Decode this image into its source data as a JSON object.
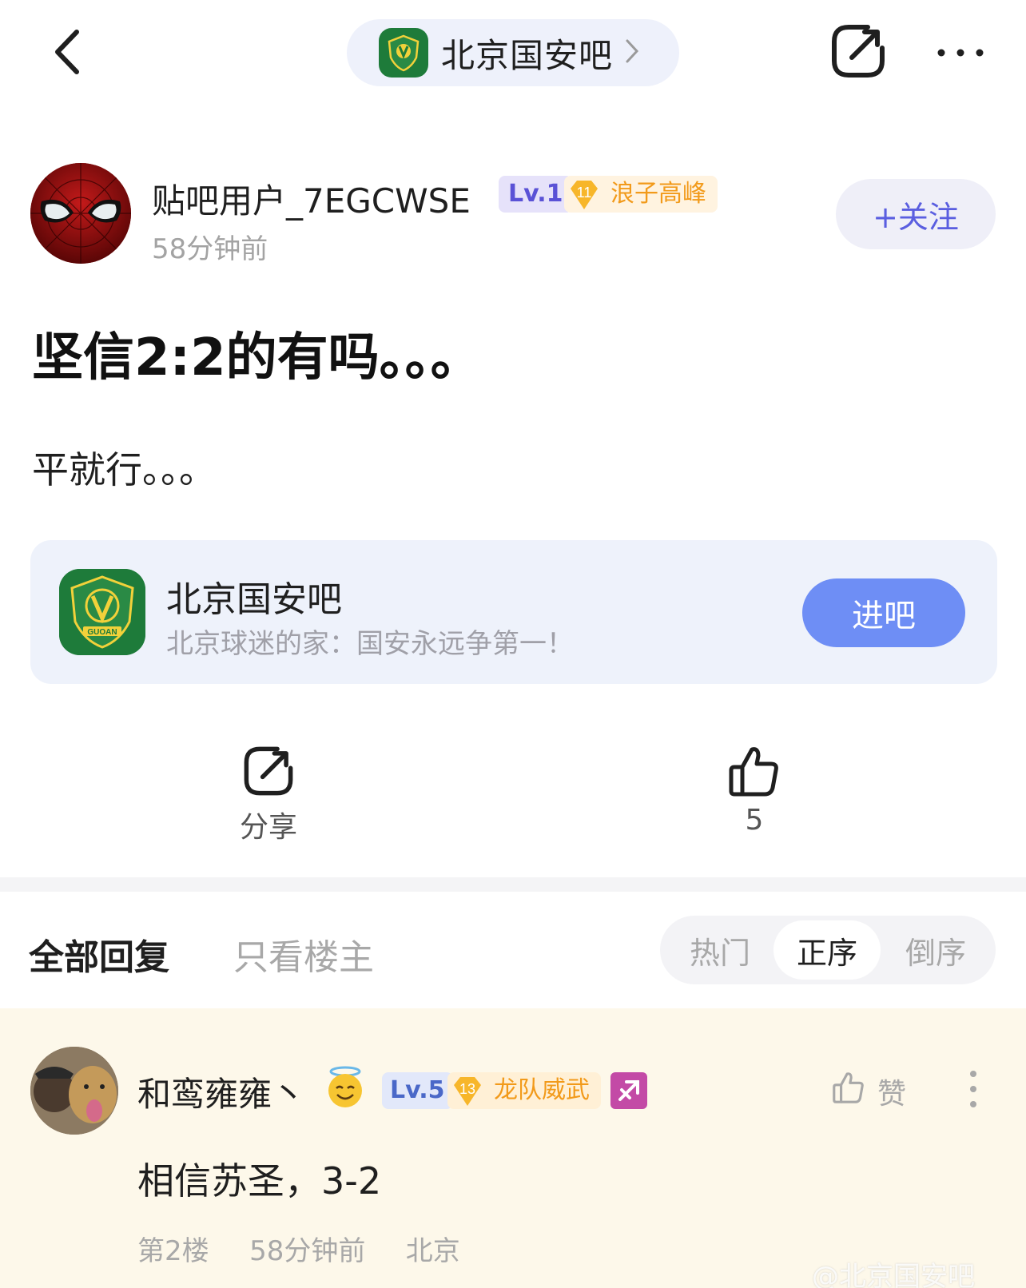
{
  "header": {
    "forum_name": "北京国安吧",
    "icons": [
      "back-arrow-icon",
      "chevron-right-icon",
      "share-icon",
      "more-dots-icon"
    ]
  },
  "author": {
    "name": "贴吧用户_7EGCWSE",
    "level": "Lv.1",
    "honor_level": "11",
    "honor_title": "浪子高峰",
    "time": "58分钟前",
    "follow_label": "+关注"
  },
  "post": {
    "title": "坚信2:2的有吗。。。",
    "body": "平就行。。。"
  },
  "forum_card": {
    "name": "北京国安吧",
    "description": "北京球迷的家：国安永远争第一！",
    "enter_label": "进吧",
    "logo_text": "GUOAN"
  },
  "actions": {
    "share_label": "分享",
    "like_count": "5"
  },
  "replies_header": {
    "tab_all": "全部回复",
    "tab_op_only": "只看楼主",
    "sort_hot": "热门",
    "sort_asc": "正序",
    "sort_desc": "倒序"
  },
  "reply": {
    "name": "和鸾雍雍丶",
    "level": "Lv.5",
    "honor_level": "13",
    "honor_title": "龙队威武",
    "like_label": "赞",
    "text": "相信苏圣，3-2",
    "floor": "第2楼",
    "time": "58分钟前",
    "location": "北京"
  },
  "watermark": "@北京国安吧",
  "colors": {
    "accent": "#6e8ef5",
    "level_purple": "#5a52d6",
    "honor_orange": "#f29a1a",
    "forum_green": "#1e7b3a",
    "reply_bg": "#fdf8ea"
  }
}
